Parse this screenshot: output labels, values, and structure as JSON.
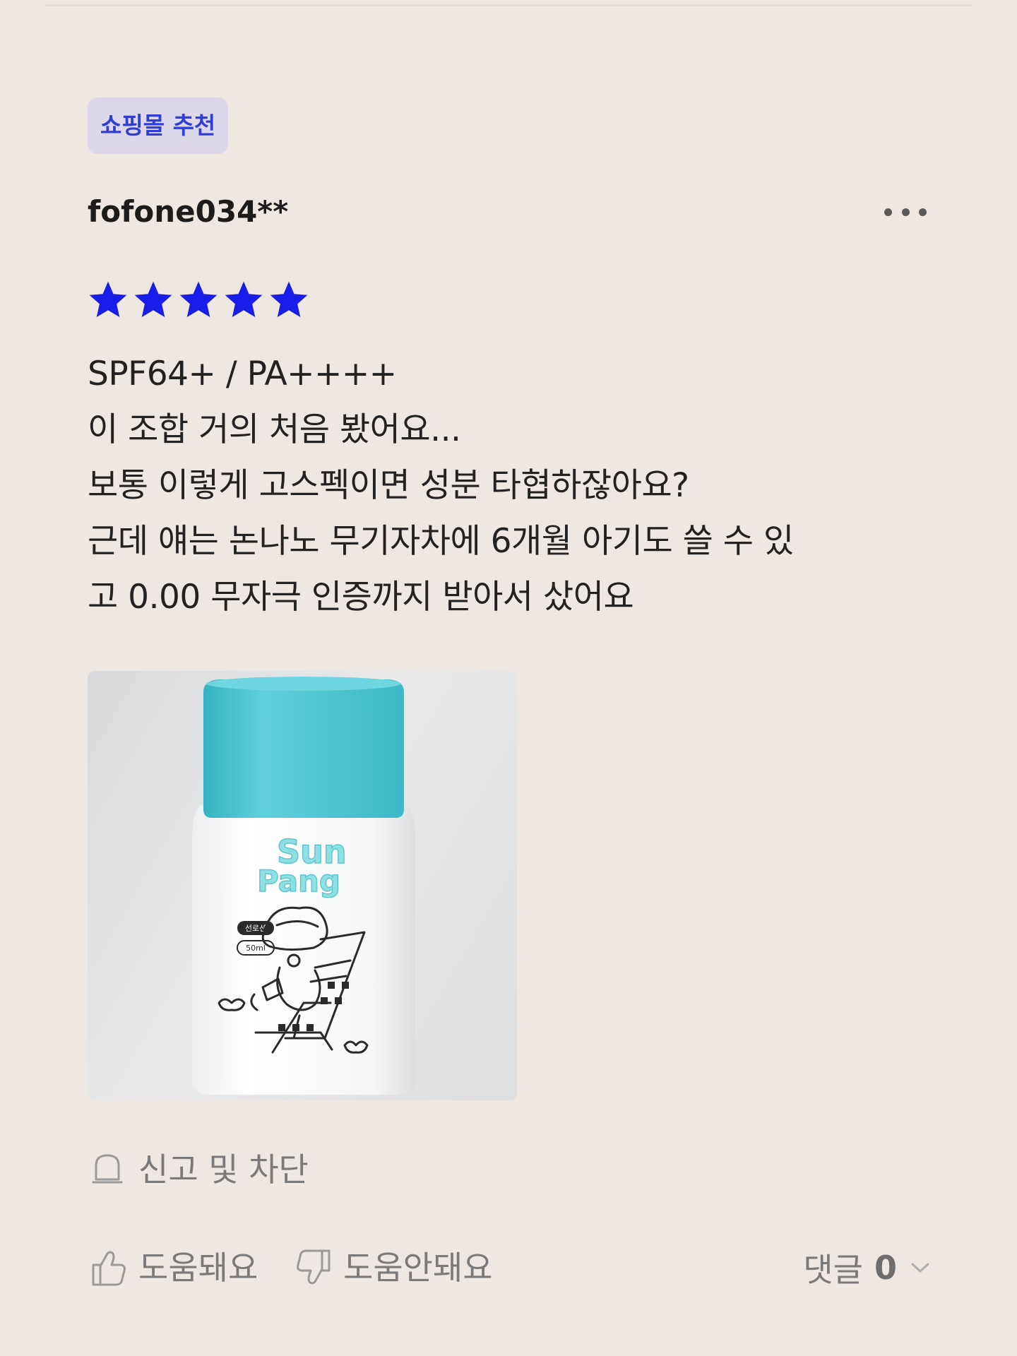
{
  "badge": {
    "label": "쇼핑몰 추천"
  },
  "review": {
    "username": "fofone034**",
    "rating": 5,
    "rating_max": 5,
    "star_color": "#1a1de8",
    "text_lines": [
      "SPF64+ / PA++++",
      "이 조합 거의 처음 봤어요...",
      "보통 이렇게 고스펙이면 성분 타협하잖아요?",
      "근데 얘는 논나노 무기자차에 6개월 아기도 쓸 수 있",
      "고 0.00 무자극 인증까지 받아서 샀어요"
    ]
  },
  "product_image": {
    "logo_line1": "Sun",
    "logo_line2": "Pang",
    "label_pill": "선로션",
    "volume_pill": "50ml",
    "cap_color": "#4cc6d4"
  },
  "report": {
    "label": "신고 및 차단",
    "icon": "flag-icon"
  },
  "actions": {
    "helpful_label": "도움돼요",
    "not_helpful_label": "도움안돼요",
    "comments_label": "댓글",
    "comments_count": "0"
  },
  "colors": {
    "background": "#efe8e2",
    "badge_bg": "#dcd8ea",
    "badge_text": "#2f3fd6",
    "muted_text": "#7a7a7a"
  }
}
